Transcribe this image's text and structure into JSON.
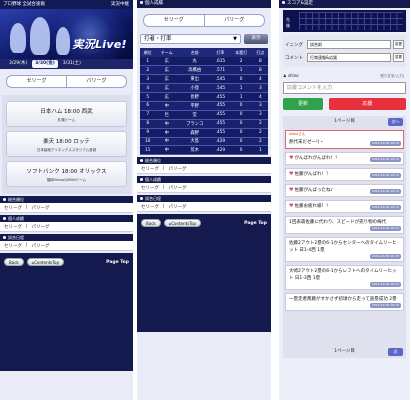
{
  "colors": {
    "navy": "#141a4d",
    "accent_green": "#2fa24a",
    "accent_red": "#e6303b"
  },
  "panel1": {
    "topbar": {
      "left": "プロ野球 全試合速報",
      "right": "実況中継"
    },
    "hero_text": "実況Live!",
    "dates": [
      "3/29(木)",
      "3/30(金)",
      "3/31(土)"
    ],
    "selected_date_index": 1,
    "tabs": [
      "セリーグ",
      "パリーグ"
    ],
    "games": [
      {
        "title": "日本ハム 18:00 西武",
        "venue": "札幌ドーム"
      },
      {
        "title": "楽天 18:00 ロッテ",
        "venue": "日本製紙クリネックススタジアム宮城"
      },
      {
        "title": "ソフトバンク 18:00 オリックス",
        "venue": "福岡Yahoo!JAPANドーム"
      }
    ],
    "sections": [
      {
        "header": "総合順位",
        "links": [
          "セリーグ",
          "パリーグ"
        ]
      },
      {
        "header": "個人成績",
        "links": [
          "セリーグ",
          "パリーグ"
        ]
      },
      {
        "header": "試合日程",
        "links": [
          "セリーグ",
          "パリーグ"
        ]
      }
    ],
    "footer": {
      "back": "Back",
      "contents_top": "ContentsTop",
      "page_top": "Page Top"
    }
  },
  "panel2": {
    "top_header": "個人成績",
    "tabs": [
      "セリーグ",
      "パリーグ"
    ],
    "dropdown": "打者・打率",
    "show_button": "表示",
    "columns": [
      "順位",
      "チーム",
      "名前",
      "打率",
      "本塁打",
      "打点"
    ],
    "rows": [
      [
        "1",
        "広",
        "丸",
        ".615",
        "2",
        "8"
      ],
      [
        "2",
        "広",
        "高橋由",
        ".571",
        "1",
        "8"
      ],
      [
        "3",
        "広",
        "東出",
        ".545",
        "0",
        "4"
      ],
      [
        "4",
        "広",
        "小窪",
        ".545",
        "1",
        "3"
      ],
      [
        "5",
        "広",
        "長野",
        ".455",
        "1",
        "4"
      ],
      [
        "6",
        "中",
        "平野",
        ".455",
        "0",
        "3"
      ],
      [
        "7",
        "巨",
        "堂",
        ".455",
        "0",
        "3"
      ],
      [
        "8",
        "中",
        "ブランコ",
        ".455",
        "0",
        "2"
      ],
      [
        "9",
        "中",
        "森野",
        ".455",
        "0",
        "2"
      ],
      [
        "10",
        "中",
        "大島",
        ".429",
        "0",
        "2"
      ],
      [
        "11",
        "中",
        "荒木",
        ".429",
        "0",
        "1"
      ]
    ],
    "sections": [
      {
        "header": "総合順位",
        "links": [
          "セリーグ",
          "パリーグ"
        ]
      },
      {
        "header": "個人成績",
        "links": [
          "セリーグ",
          "パリーグ"
        ]
      },
      {
        "header": "試合日程",
        "links": [
          "セリーグ",
          "パリーグ"
        ]
      }
    ],
    "footer": {
      "back": "Back",
      "contents_top": "ContentsTop",
      "page_top": "Page Top"
    }
  },
  "panel3": {
    "header": "スコア&設定",
    "score_labels": [
      "先",
      "後"
    ],
    "inning_label": "イニング",
    "inning_value": "試合前",
    "comment_label": "コメント",
    "comment_value": "打席速報&応援",
    "change_button": "変更",
    "username": "shino",
    "char_count": "残り文字(入力)",
    "cheer_placeholder": "応援コメントを入力",
    "update_button": "更新",
    "cheer_button": "応援",
    "page_label": "1ページ目",
    "next_button": "次へ",
    "posts": [
      {
        "user": "shinoさん",
        "text": "熱代末だゼー!(・ ",
        "highlight": true
      },
      {
        "user": "",
        "text": "がんばれがんばれ！！",
        "heart": true
      },
      {
        "user": "",
        "text": "佐藤がんばれ！！",
        "heart": true
      },
      {
        "user": "",
        "text": "佐藤がんばったね♪",
        "heart": true
      },
      {
        "user": "",
        "text": "佐藤お疲れ様！！",
        "heart": true
      },
      {
        "user": "",
        "text": "1回表森佐藤に代わり、スピードが売り物の梅代",
        "heart": false
      },
      {
        "user": "",
        "text": "佐藤2アウト2塁の6-1からセンターへのタイムリーヒット 日1-4西 1塁",
        "heart": false
      },
      {
        "user": "",
        "text": "大崎2アウト2塁の6-1からレフトへのタイムリーヒット 日1-3西 1塁",
        "heart": false
      },
      {
        "user": "",
        "text": "一塁走者斎藤がすかさず初球から走って盗塁成功 2塁",
        "heart": false
      }
    ],
    "post_time": "2012-03-30 18:15",
    "bottom_page_label": "1ページ目",
    "bottom_next": "次"
  }
}
